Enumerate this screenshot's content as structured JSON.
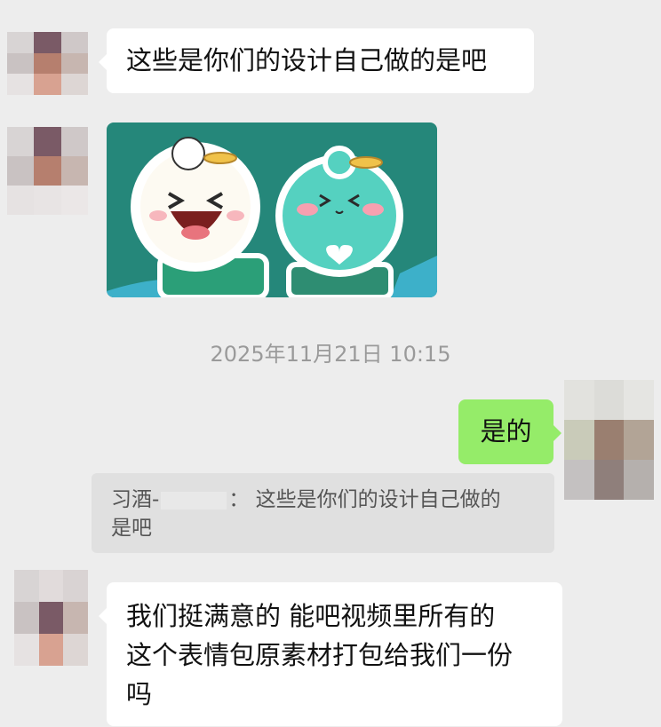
{
  "messages": {
    "m1": {
      "text": "这些是你们的设计自己做的是吧"
    },
    "m2": {
      "sticker": "cartoon-sticker-two-characters"
    },
    "timestamp": "2025年11月21日 10:15",
    "m3": {
      "text": "是的"
    },
    "quote": {
      "sender": "习酒-",
      "separator": "：",
      "line1": "这些是你们的设计自己做的",
      "line2": "是吧"
    },
    "m4": {
      "line1": "我们挺满意的 能吧视频里所有的",
      "line2": "这个表情包原素材打包给我们一份",
      "line3": "吗"
    }
  },
  "colors": {
    "background": "#ededed",
    "bubble_left": "#ffffff",
    "bubble_right": "#95ec69",
    "sticker_bg": "#25877a"
  }
}
